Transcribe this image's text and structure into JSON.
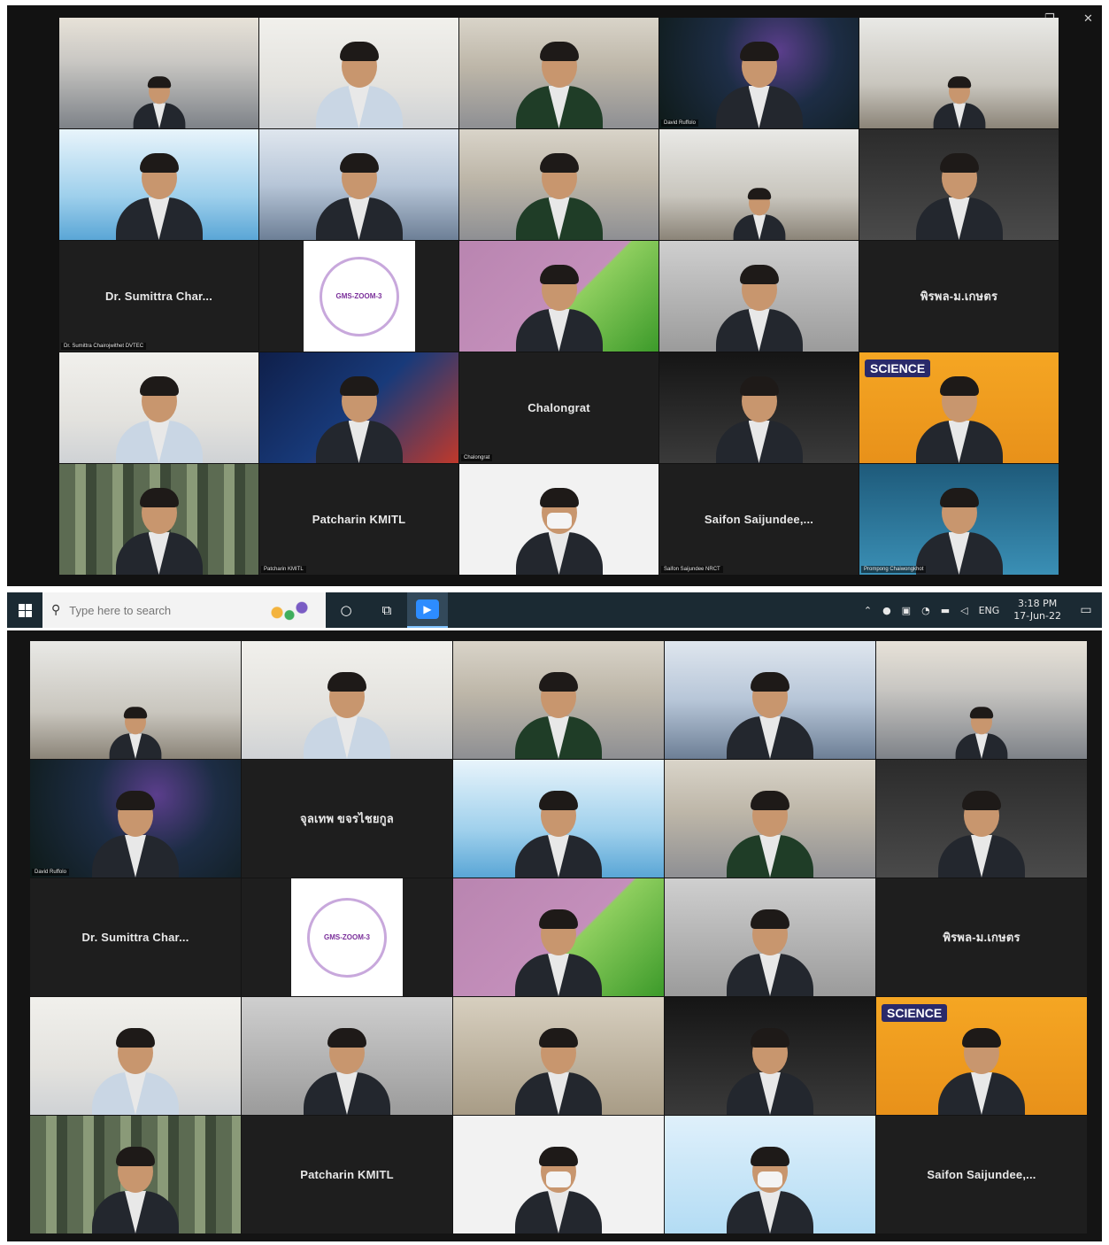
{
  "screen1": {
    "window_controls": {
      "minimize": "—",
      "restore": "❐",
      "close": "✕"
    },
    "tiles": [
      {
        "name": "",
        "display_name": "",
        "bg": "conf"
      },
      {
        "name": "",
        "display_name": "",
        "bg": "bright"
      },
      {
        "name": "",
        "display_name": "",
        "bg": "office"
      },
      {
        "name": "David Ruffolo",
        "display_name": "",
        "bg": "space"
      },
      {
        "name": "",
        "display_name": "",
        "bg": "room"
      },
      {
        "name": "",
        "display_name": "",
        "bg": "blue"
      },
      {
        "name": "",
        "display_name": "",
        "bg": "blurblue"
      },
      {
        "name": "",
        "display_name": "",
        "bg": "office"
      },
      {
        "name": "",
        "display_name": "",
        "bg": "room"
      },
      {
        "name": "",
        "display_name": "",
        "bg": "dark"
      },
      {
        "name": "Dr. Sumittra Chairojwithet DVTEC",
        "display_name": "Dr. Sumittra Char...",
        "bg": "text"
      },
      {
        "name": "",
        "display_name": "",
        "bg": "logo",
        "logo_text": "GMS-ZOOM-3"
      },
      {
        "name": "",
        "display_name": "",
        "bg": "green"
      },
      {
        "name": "",
        "display_name": "",
        "bg": "gray"
      },
      {
        "name": "",
        "display_name": "พิรพล-ม.เกษตร",
        "bg": "text"
      },
      {
        "name": "",
        "display_name": "",
        "bg": "bright"
      },
      {
        "name": "",
        "display_name": "",
        "bg": "tsri"
      },
      {
        "name": "Chalongrat",
        "display_name": "Chalongrat",
        "bg": "text"
      },
      {
        "name": "",
        "display_name": "",
        "bg": "kmitl"
      },
      {
        "name": "",
        "display_name": "",
        "bg": "orange",
        "logo_text": "SCIENCE"
      },
      {
        "name": "",
        "display_name": "",
        "bg": "bokeh"
      },
      {
        "name": "Patcharin KMITL",
        "display_name": "Patcharin KMITL",
        "bg": "text"
      },
      {
        "name": "",
        "display_name": "",
        "bg": "white"
      },
      {
        "name": "Saifon Saijundee NRCT",
        "display_name": "Saifon  Saijundee,...",
        "bg": "text"
      },
      {
        "name": "Prompong Chaiwongkhot",
        "display_name": "",
        "bg": "teal"
      }
    ]
  },
  "taskbar": {
    "search_placeholder": "Type here to search",
    "language": "ENG",
    "time": "3:18 PM",
    "date": "17-Jun-22",
    "icons": {
      "start": "windows-logo",
      "search": "search-icon",
      "cortana": "cortana-icon",
      "task_view": "task-view-icon",
      "zoom": "zoom-app-icon",
      "notifications": "notification-icon"
    }
  },
  "screen2": {
    "tiles": [
      {
        "name": "",
        "display_name": "",
        "bg": "room"
      },
      {
        "name": "",
        "display_name": "",
        "bg": "bright"
      },
      {
        "name": "",
        "display_name": "",
        "bg": "office"
      },
      {
        "name": "",
        "display_name": "",
        "bg": "blurblue"
      },
      {
        "name": "",
        "display_name": "",
        "bg": "conf"
      },
      {
        "name": "David Ruffolo",
        "display_name": "",
        "bg": "space"
      },
      {
        "name": "",
        "display_name": "จุลเทพ ขจรไชยกูล",
        "bg": "text"
      },
      {
        "name": "",
        "display_name": "",
        "bg": "blue"
      },
      {
        "name": "",
        "display_name": "",
        "bg": "office"
      },
      {
        "name": "",
        "display_name": "",
        "bg": "dark"
      },
      {
        "name": "",
        "display_name": "Dr. Sumittra Char...",
        "bg": "text"
      },
      {
        "name": "",
        "display_name": "",
        "bg": "logo",
        "logo_text": "GMS-ZOOM-3"
      },
      {
        "name": "",
        "display_name": "",
        "bg": "green"
      },
      {
        "name": "",
        "display_name": "",
        "bg": "gray"
      },
      {
        "name": "",
        "display_name": "พิรพล-ม.เกษตร",
        "bg": "text"
      },
      {
        "name": "",
        "display_name": "",
        "bg": "bright"
      },
      {
        "name": "",
        "display_name": "",
        "bg": "gray"
      },
      {
        "name": "",
        "display_name": "",
        "bg": "warm"
      },
      {
        "name": "",
        "display_name": "",
        "bg": "kmitl"
      },
      {
        "name": "",
        "display_name": "",
        "bg": "orange",
        "logo_text": "SCIENCE"
      },
      {
        "name": "",
        "display_name": "",
        "bg": "bokeh"
      },
      {
        "name": "",
        "display_name": "Patcharin KMITL",
        "bg": "text"
      },
      {
        "name": "",
        "display_name": "",
        "bg": "white"
      },
      {
        "name": "",
        "display_name": "",
        "bg": "skyblue"
      },
      {
        "name": "",
        "display_name": "Saifon  Saijundee,...",
        "bg": "text"
      }
    ]
  }
}
